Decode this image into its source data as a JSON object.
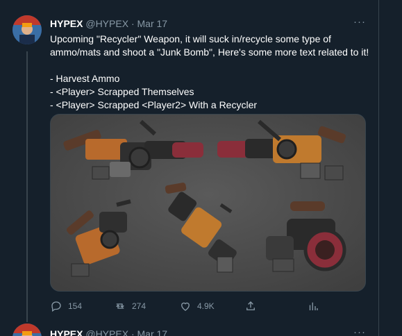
{
  "tweet": {
    "author_name": "HYPEX",
    "author_handle": "@HYPEX",
    "separator": "·",
    "date": "Mar 17",
    "more_label": "···",
    "text_lines": [
      "Upcoming \"Recycler\" Weapon, it will suck in/recycle some type of ammo/mats and shoot a \"Junk Bomb\", Here's some more text related to it!",
      "- Harvest Ammo",
      "- <Player> Scrapped Themselves",
      "- <Player> Scrapped <Player2> With a Recycler"
    ],
    "media_description_icon": "recycler-weapon-render",
    "actions": {
      "replies": "154",
      "retweets": "274",
      "likes": "4.9K"
    }
  },
  "next_tweet": {
    "author_name": "HYPEX",
    "author_handle": "@HYPEX",
    "separator": "·",
    "date": "Mar 17",
    "more_label": "···"
  },
  "colors": {
    "background": "#15202b",
    "secondary_text": "#8899a6",
    "border": "#38444d"
  }
}
